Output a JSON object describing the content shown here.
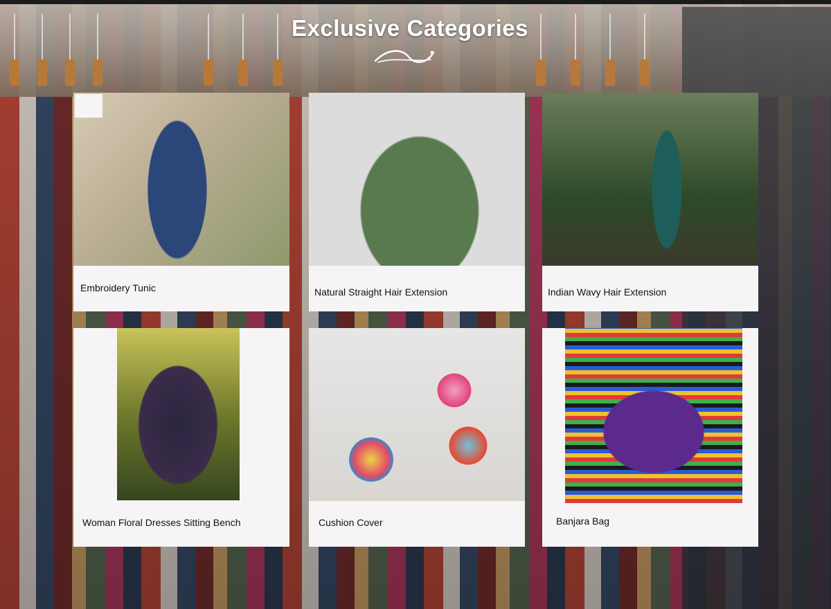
{
  "section": {
    "title": "Exclusive Categories",
    "ornament_icon": "swirl-divider-icon"
  },
  "categories": [
    {
      "label": "Embroidery Tunic"
    },
    {
      "label": "Natural Straight Hair Extension"
    },
    {
      "label": "Indian Wavy Hair Extension"
    },
    {
      "label": "Woman Floral Dresses Sitting Bench"
    },
    {
      "label": "Cushion Cover"
    },
    {
      "label": "Banjara Bag"
    }
  ],
  "colors": {
    "card_background": "#f6f4f5",
    "heading_text": "#ffffff",
    "label_text": "#111111"
  }
}
